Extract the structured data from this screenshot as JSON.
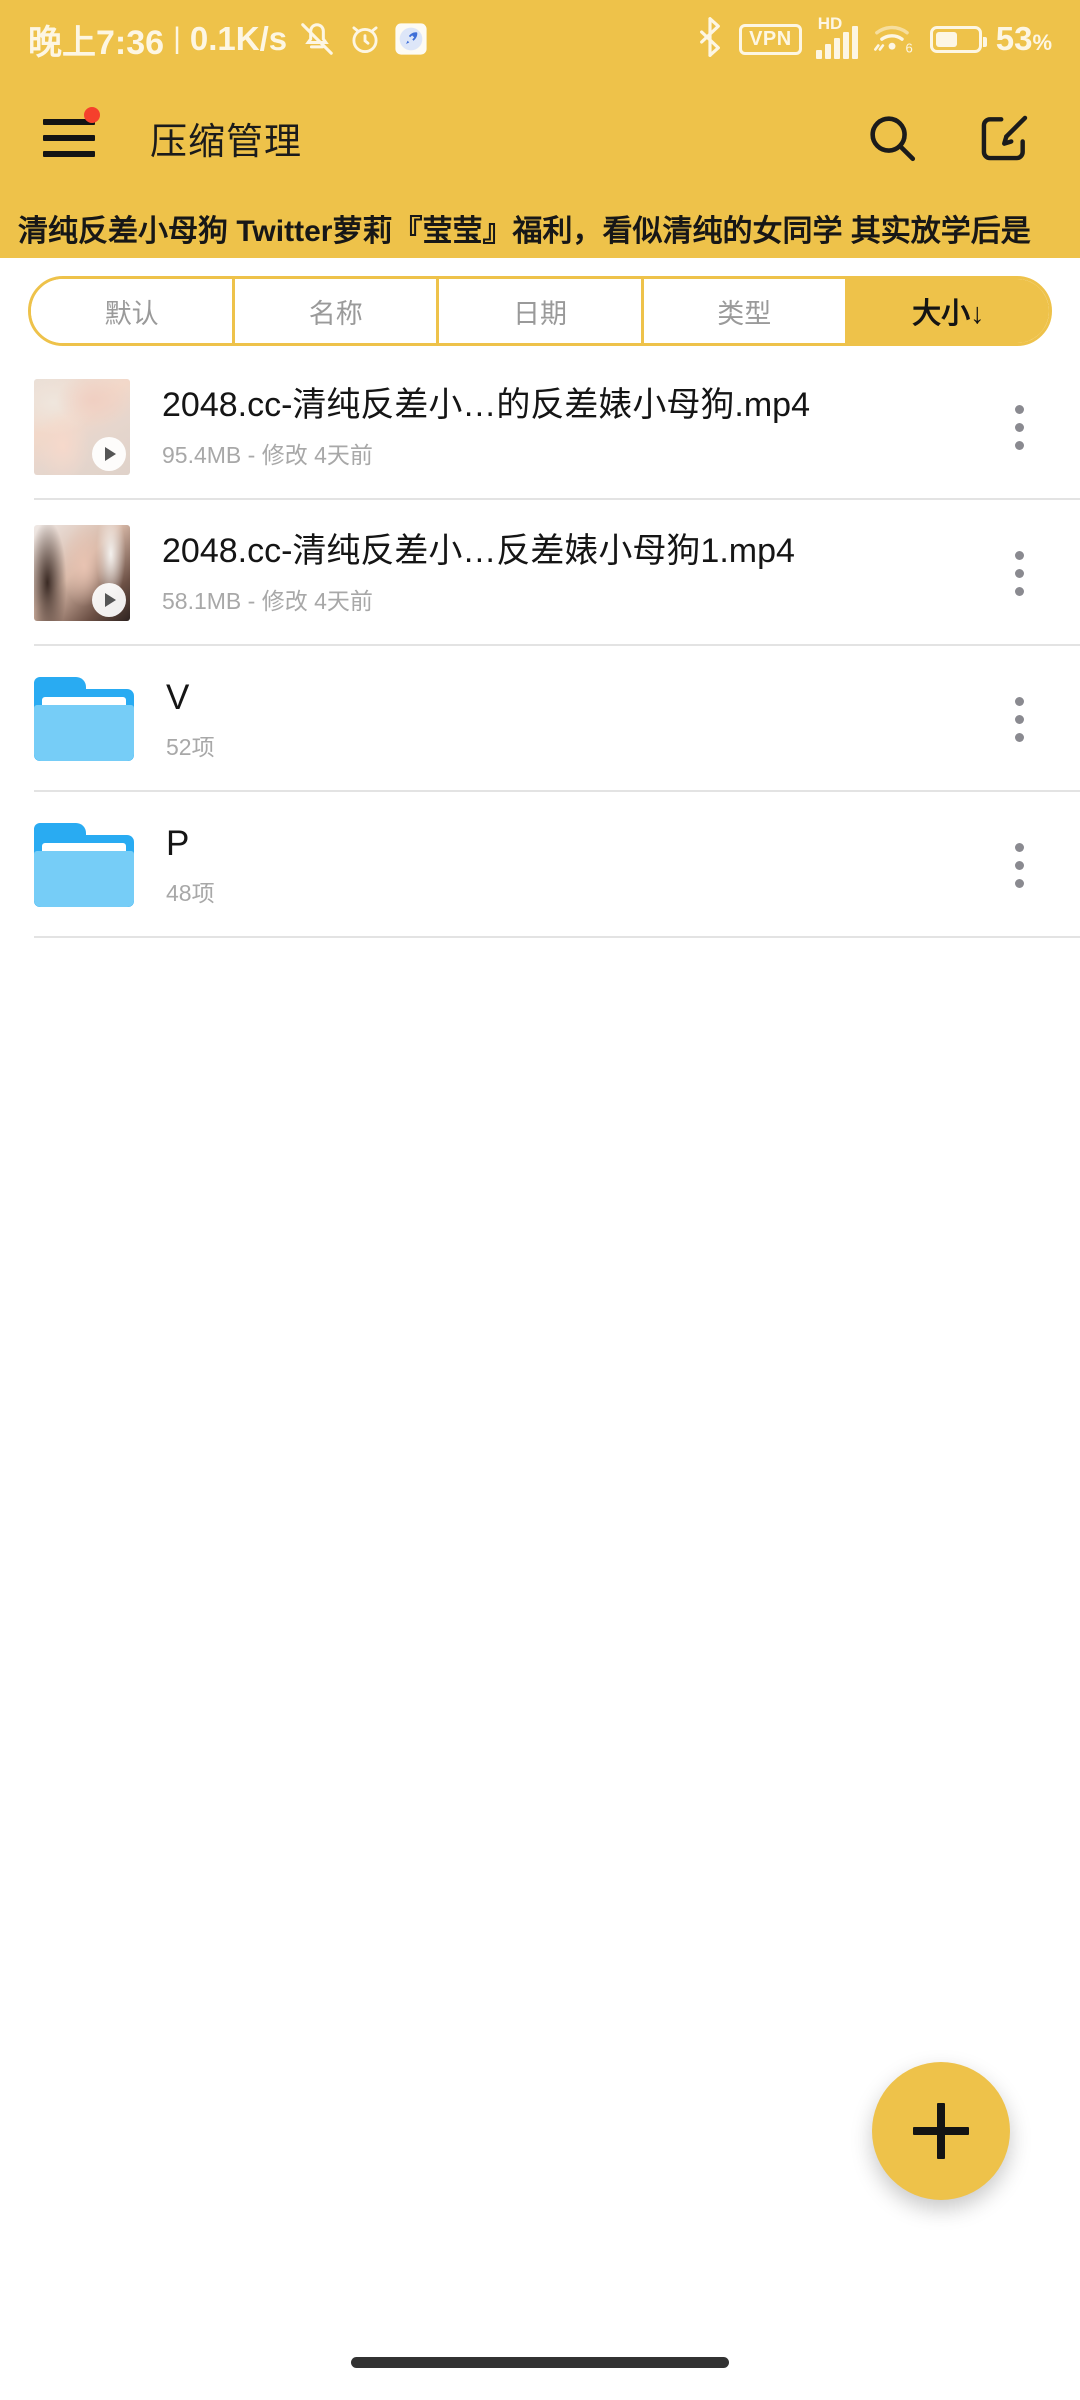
{
  "theme": {
    "accent": "#eec24a",
    "status_text": "#fdf6e3",
    "folder_blue": "#76cdf7",
    "badge_red": "#f5402c"
  },
  "statusbar": {
    "clock": "晚上7:36",
    "separator": "|",
    "net_rate": "0.1K/s",
    "left_icons": [
      "mute-icon",
      "alarm-icon",
      "rocket-boost-icon"
    ],
    "right_icons": [
      "bluetooth-icon",
      "vpn-icon",
      "hd-signal-icon",
      "wifi6-icon",
      "battery-icon"
    ],
    "vpn_label": "VPN",
    "hd_label": "HD",
    "wifi_gen": "6",
    "battery_percent": "53",
    "battery_percent_symbol": "%",
    "battery_level": 53
  },
  "appbar": {
    "menu_icon": "hamburger-menu-icon",
    "menu_badge": true,
    "title": "压缩管理",
    "actions": [
      {
        "name": "search-icon",
        "label": "搜索"
      },
      {
        "name": "compose-edit-icon",
        "label": "新建"
      }
    ]
  },
  "pathbar": {
    "text": "清纯反差小母狗 Twitter萝莉『莹莹』福利，看似清纯的女同学 其实放学后是"
  },
  "sort": {
    "tabs": [
      {
        "label": "默认",
        "active": false
      },
      {
        "label": "名称",
        "active": false
      },
      {
        "label": "日期",
        "active": false
      },
      {
        "label": "类型",
        "active": false
      },
      {
        "label": "大小↓",
        "active": true
      }
    ]
  },
  "files": [
    {
      "type": "video",
      "icon": "video-thumbnail",
      "name": "2048.cc-清纯反差小…的反差婊小母狗.mp4",
      "size": "95.4MB",
      "sub": "95.4MB - 修改 4天前",
      "modified": "修改 4天前",
      "menu_icon": "more-vertical-icon"
    },
    {
      "type": "video",
      "icon": "video-thumbnail",
      "name": "2048.cc-清纯反差小…反差婊小母狗1.mp4",
      "size": "58.1MB",
      "sub": "58.1MB - 修改 4天前",
      "modified": "修改 4天前",
      "menu_icon": "more-vertical-icon"
    },
    {
      "type": "folder",
      "icon": "folder-icon",
      "name": "V",
      "sub": "52项",
      "count": 52,
      "menu_icon": "more-vertical-icon"
    },
    {
      "type": "folder",
      "icon": "folder-icon",
      "name": "P",
      "sub": "48项",
      "count": 48,
      "menu_icon": "more-vertical-icon"
    }
  ],
  "fab": {
    "icon": "plus-icon",
    "label": "添加"
  },
  "navbar": {
    "gesture_pill": "home-gesture-pill"
  }
}
